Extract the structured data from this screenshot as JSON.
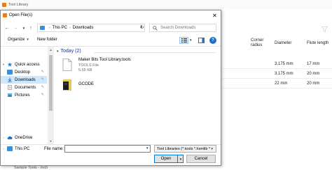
{
  "background_app": {
    "title": "Tool Library",
    "columns": {
      "corner_radius": "Corner radius",
      "diameter": "Diameter",
      "flute_length": "Flute length"
    },
    "rows": [
      {
        "diameter": "3.175 mm",
        "flute_length": "17 mm"
      },
      {
        "diameter": "3.175 mm",
        "flute_length": "20 mm"
      },
      {
        "diameter": "22 mm",
        "flute_length": "20 mm"
      }
    ],
    "bottom_text": "Sample Tools - Inch"
  },
  "dialog": {
    "title": "Open File(s)",
    "breadcrumb": [
      "This PC",
      "Downloads"
    ],
    "search_placeholder": "Search Downloads",
    "toolbar": {
      "organize": "Organize",
      "new_folder": "New folder"
    },
    "nav_items": [
      {
        "label": "Quick access",
        "icon": "star-icon",
        "pinned": false,
        "selected": false
      },
      {
        "label": "Desktop",
        "icon": "desktop-icon",
        "pinned": true,
        "selected": false
      },
      {
        "label": "Downloads",
        "icon": "downloads-icon",
        "pinned": true,
        "selected": true
      },
      {
        "label": "Documents",
        "icon": "documents-icon",
        "pinned": true,
        "selected": false
      },
      {
        "label": "Pictures",
        "icon": "pictures-icon",
        "pinned": true,
        "selected": false
      },
      {
        "label": "OneDrive",
        "icon": "cloud-icon",
        "pinned": false,
        "selected": false
      },
      {
        "label": "This PC",
        "icon": "pc-icon",
        "pinned": false,
        "selected": false
      }
    ],
    "group_label": "Today (2)",
    "files": [
      {
        "name": "Maker Bits Tool Library.tools",
        "type": "TOOLS File",
        "size": "5.55 KB",
        "icon": "document-icon"
      },
      {
        "name": "GCODE",
        "type": "",
        "size": "",
        "icon": "folder-icon"
      }
    ],
    "file_name_label": "File name:",
    "file_name_value": "",
    "file_type": "Tool Libraries (*.tools *.hsmlib *",
    "open_label": "Open",
    "cancel_label": "Cancel",
    "colors": {
      "accent": "#0078d7",
      "selection": "#cce8ff",
      "brand": "#ef7d0a"
    }
  }
}
